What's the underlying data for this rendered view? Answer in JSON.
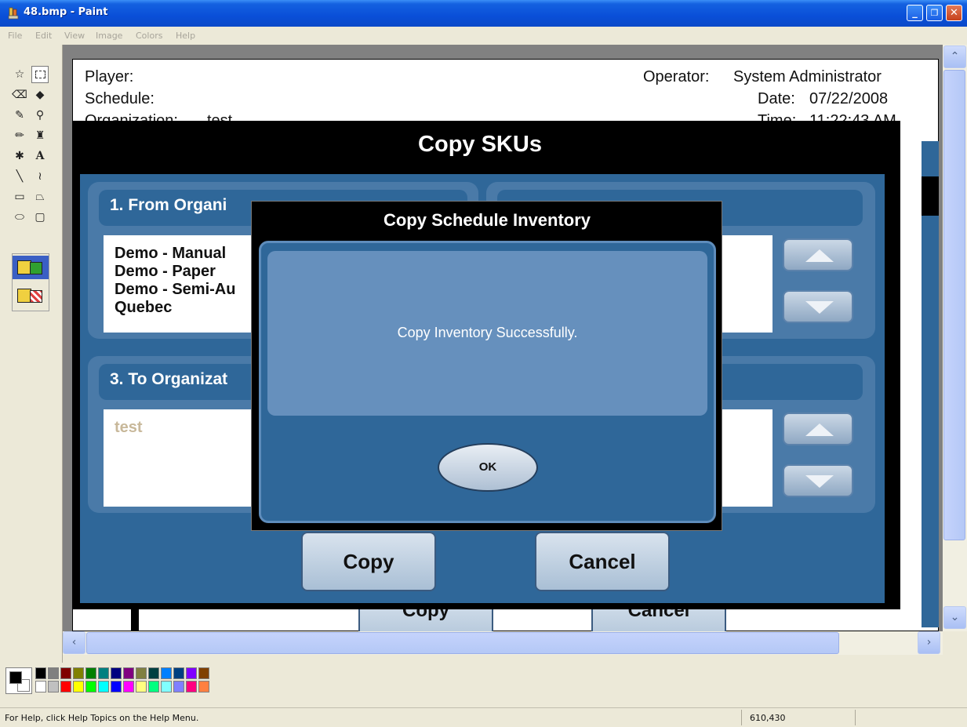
{
  "window": {
    "title": "48.bmp - Paint",
    "controls": {
      "minimize": "_",
      "restore": "❐",
      "close": "✕"
    }
  },
  "menubar": {
    "items": [
      "File",
      "Edit",
      "View",
      "Image",
      "Colors",
      "Help"
    ]
  },
  "toolbox": {
    "tools": [
      "free-select",
      "rect-select",
      "eraser",
      "fill",
      "color-picker",
      "magnifier",
      "pencil",
      "brush",
      "airbrush",
      "text",
      "line",
      "curve",
      "rectangle",
      "polygon",
      "ellipse",
      "rounded-rectangle"
    ]
  },
  "image_content": {
    "header": {
      "player_label": "Player:",
      "schedule_label": "Schedule:",
      "organization_label": "Organization:",
      "organization_value": "test",
      "operator_label": "Operator:",
      "operator_value": "System Administrator",
      "date_label": "Date:",
      "date_value": "07/22/2008",
      "time_label": "Time:",
      "time_value": "11:22:43 AM"
    },
    "copy_skus": {
      "title": "Copy SKUs",
      "from_panel": {
        "heading": "1. From Organi",
        "items": [
          "Demo - Manual",
          "Demo - Paper",
          "Demo - Semi-Au",
          "Quebec"
        ]
      },
      "to_panel": {
        "heading": "3. To Organizat",
        "items": [
          "test"
        ]
      },
      "copy_button": "Copy",
      "cancel_button": "Cancel",
      "background_copy": "Copy",
      "background_cancel": "Cancel"
    },
    "modal": {
      "title": "Copy Schedule Inventory",
      "message": "Copy Inventory Successfully.",
      "ok_button": "OK"
    }
  },
  "palette": {
    "row1": [
      "#000000",
      "#808080",
      "#800000",
      "#808000",
      "#008000",
      "#008080",
      "#000080",
      "#800080",
      "#808040",
      "#004040",
      "#0080ff",
      "#004080",
      "#8000ff",
      "#804000"
    ],
    "row2": [
      "#ffffff",
      "#c0c0c0",
      "#ff0000",
      "#ffff00",
      "#00ff00",
      "#00ffff",
      "#0000ff",
      "#ff00ff",
      "#ffff80",
      "#00ff80",
      "#80ffff",
      "#8080ff",
      "#ff0080",
      "#ff8040"
    ]
  },
  "statusbar": {
    "help_text": "For Help, click Help Topics on the Help Menu.",
    "coordinates": "610,430"
  }
}
